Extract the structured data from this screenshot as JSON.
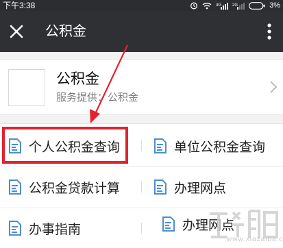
{
  "status_bar": {
    "time": "下午3:38",
    "signal_labels": [
      "4G",
      "2G"
    ],
    "battery": "3%"
  },
  "nav": {
    "title": "公积金",
    "close_icon": "close-icon",
    "more_icon": "more-vertical-icon"
  },
  "account": {
    "name": "公积金",
    "provider": "服务提供：公积金"
  },
  "menu": {
    "items": [
      {
        "label": "个人公积金查询",
        "icon": "document-edit-icon"
      },
      {
        "label": "单位公积金查询",
        "icon": "document-edit-icon"
      },
      {
        "label": "公积金贷款计算",
        "icon": "document-edit-icon"
      },
      {
        "label": "办理网点",
        "icon": "document-edit-icon"
      },
      {
        "label": "办事指南",
        "icon": "document-edit-icon"
      },
      {
        "label": "办理网点",
        "icon": "document-edit-icon"
      }
    ]
  },
  "watermark": {
    "text": "www.xiazaiba.com"
  },
  "colors": {
    "nav_bg": "#2e3034",
    "status_bg": "#2b2d31",
    "icon_blue": "#4a8fd0",
    "highlight_red": "#e2232e"
  }
}
